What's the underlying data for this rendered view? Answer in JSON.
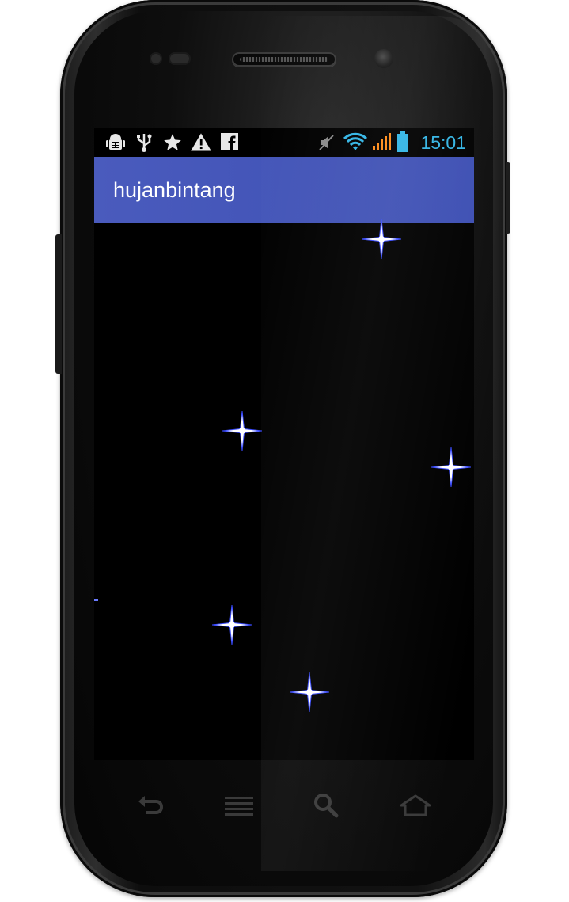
{
  "status_bar": {
    "time": "15:01",
    "icons": [
      "android-debug-icon",
      "usb-icon",
      "star-icon",
      "warning-icon",
      "facebook-icon",
      "mute-icon",
      "wifi-icon",
      "signal-icon",
      "battery-icon"
    ]
  },
  "app": {
    "title": "hujanbintang"
  },
  "canvas": {
    "background": "#000000",
    "star_color": "#ffffff",
    "star_glow": "#3a4bff"
  },
  "nav_bar": {
    "buttons": [
      "back-icon",
      "menu-icon",
      "search-icon",
      "home-icon"
    ]
  },
  "colors": {
    "action_bar": "#3f51b5",
    "clock": "#33b5e5"
  }
}
